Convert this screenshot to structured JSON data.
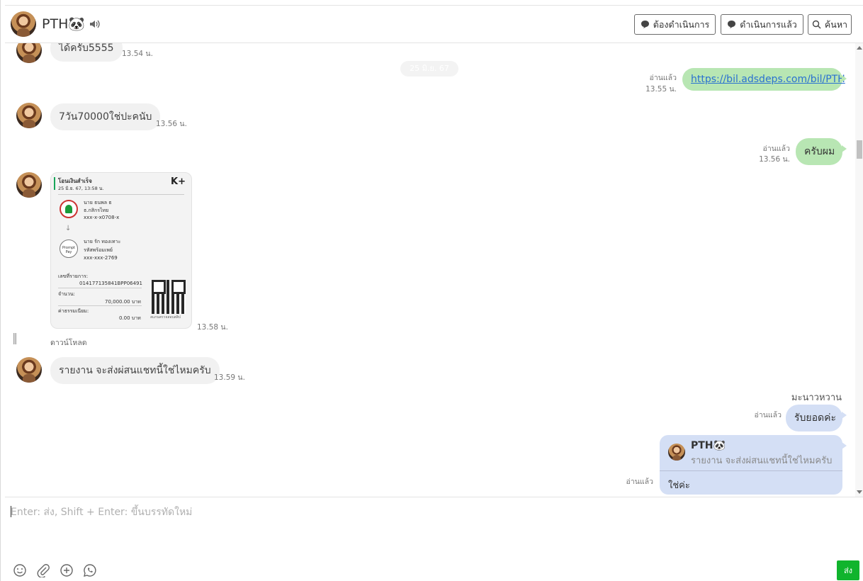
{
  "header": {
    "name": "PTH🐼",
    "buttons": [
      "ต้องดำเนินการ",
      "ดำเนินการแล้ว",
      "ค้นหา"
    ]
  },
  "messages": {
    "m1": {
      "text": "ได้ครับ5555",
      "time": "13.54 น."
    },
    "date": "25 มิ.ย. 67",
    "m2": {
      "text": "https://bil.adsdeps.com/bil/PTH",
      "read": "อ่านแล้ว",
      "time": "13.55 น."
    },
    "m3": {
      "text": "7วัน70000ใช่ปะคนับ",
      "time": "13.56 น."
    },
    "m4": {
      "text": "ครับผม",
      "read": "อ่านแล้ว",
      "time": "13.56 น."
    },
    "slip": {
      "title": "โอนเงินสำเร็จ",
      "date": "25 มิ.ย. 67, 13:58 น.",
      "brand": "K+",
      "from_name": "นาย ธนพล ธ",
      "from_bank": "ธ.กสิกรไทย",
      "from_acct": "xxx-x-x0708-x",
      "to_name": "นาย รัก ทองเทาะ",
      "to_bank": "รหัสพร้อมเพย์",
      "to_acct": "xxx-xxx-2769",
      "ref_label": "เลขที่รายการ:",
      "ref": "014177135841BPP06491",
      "amount_label": "จำนวน:",
      "amount": "70,000.00 บาท",
      "fee_label": "ค่าธรรมเนียม:",
      "fee": "0.00 บาท",
      "promptpay": "Prompt Pay",
      "qr_caption": "สแกนตรวจสอบสลิป",
      "time": "13.58 น.",
      "download": "ดาวน์โหลด"
    },
    "m5": {
      "text": "รายงาน จะส่งผ่สนแชทนี้ใช่ไหมครับ",
      "time": "13.59 น."
    },
    "sender": "มะนาวหวาน",
    "m6": {
      "text": "รับยอดค่ะ",
      "read": "อ่านแล้ว"
    },
    "reply": {
      "name": "PTH🐼",
      "quote": "รายงาน จะส่งผ่สนแชทนี้ใช่ไหมครับ",
      "text": "ใช่ค่ะ",
      "read": "อ่านแล้ว"
    }
  },
  "composer": {
    "placeholder": "Enter: ส่ง, Shift + Enter: ขึ้นบรรทัดใหม่",
    "send": "ส่ง"
  },
  "colors": {
    "outgoing": "#b8e6b3",
    "incoming": "#f1f1f1",
    "admin": "#d4dff5",
    "send": "#10b42d"
  },
  "icons": [
    "speaker-icon",
    "chat-bubble-icon",
    "search-icon",
    "emoji-icon",
    "attachment-icon",
    "plus-circle-icon",
    "whatsapp-icon"
  ]
}
